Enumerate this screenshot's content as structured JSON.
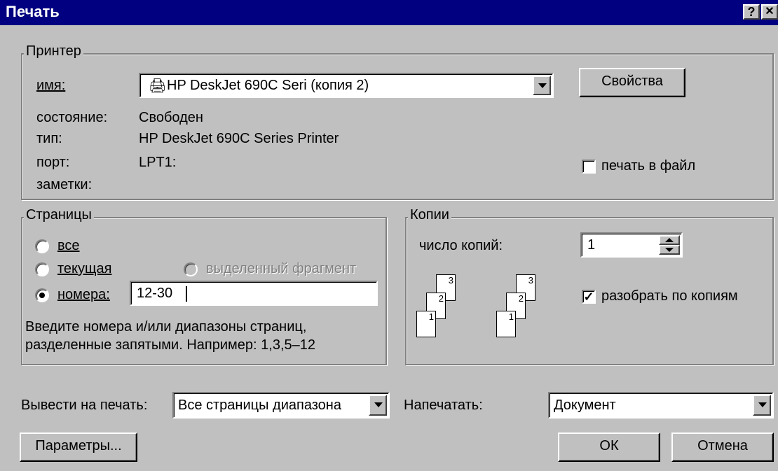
{
  "window": {
    "title": "Печать",
    "help_glyph": "?",
    "close_glyph": "✕"
  },
  "printer": {
    "group_label": "Принтер",
    "name_label": "имя:",
    "name_value": "HP DeskJet 690C Seri (копия 2)",
    "status_label": "состояние:",
    "status_value": "Свободен",
    "type_label": "тип:",
    "type_value": "HP DeskJet 690C Series Printer",
    "port_label": "порт:",
    "port_value": "LPT1:",
    "notes_label": "заметки:",
    "properties_button": "Свойства",
    "print_to_file_label": "печать в файл",
    "print_to_file_checked": false
  },
  "pages": {
    "group_label": "Страницы",
    "all_label": "все",
    "current_label": "текущая",
    "selection_label": "выделенный фрагмент",
    "numbers_label": "номера:",
    "numbers_value": "12-30",
    "selected": "numbers",
    "hint_line1": "Введите номера и/или диапазоны страниц,",
    "hint_line2": "разделенные запятыми. Например: 1,3,5–12"
  },
  "copies": {
    "group_label": "Копии",
    "count_label": "число копий:",
    "count_value": "1",
    "collate_label": "разобрать по копиям",
    "collate_checked": true,
    "page_numbers": [
      "1",
      "2",
      "3"
    ]
  },
  "output": {
    "print_label": "Вывести на печать:",
    "print_value": "Все страницы диапазона",
    "what_label": "Напечатать:",
    "what_value": "Документ"
  },
  "buttons": {
    "options": "Параметры...",
    "ok": "ОК",
    "cancel": "Отмена"
  }
}
